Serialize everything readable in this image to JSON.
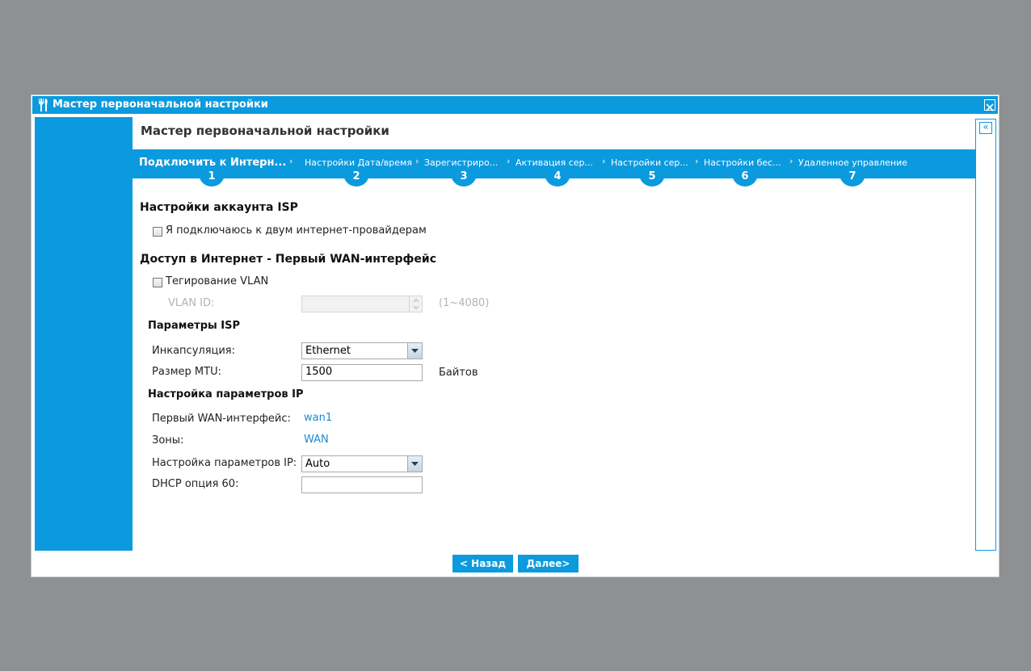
{
  "window": {
    "title": "Мастер первоначальной настройки",
    "title_icon": "tools-icon",
    "close_icon": "close-icon",
    "collapse_icon": "double-chevron-left-icon",
    "collapse_glyph": "«"
  },
  "wizard": {
    "title": "Мастер первоначальной настройки",
    "accent_color": "#0b9ade",
    "steps": [
      {
        "label": "Подключить к Интерн...",
        "number": "1",
        "active": true
      },
      {
        "label": "Настройки Дата/время",
        "number": "2"
      },
      {
        "label": "Зарегистриро...",
        "number": "3"
      },
      {
        "label": "Активация сер...",
        "number": "4"
      },
      {
        "label": "Настройки сер...",
        "number": "5"
      },
      {
        "label": "Настройки бес...",
        "number": "6"
      },
      {
        "label": "Удаленное управление",
        "number": "7"
      }
    ]
  },
  "isp_account": {
    "heading": "Настройки аккаунта ISP",
    "dual_isp_label": "Я подключаюсь к двум интернет-провайдерам",
    "dual_isp_checked": false
  },
  "internet_access": {
    "heading": "Доступ в Интернет - Первый WAN-интерфейс",
    "vlan_tagging_label": "Тегирование VLAN",
    "vlan_tagging_checked": false,
    "vlan_id_label": "VLAN ID:",
    "vlan_id_value": "",
    "vlan_id_range": "(1~4080)"
  },
  "isp_params": {
    "heading": "Параметры ISP",
    "encapsulation_label": "Инкапсуляция:",
    "encapsulation_value": "Ethernet",
    "mtu_label": "Размер MTU:",
    "mtu_value": "1500",
    "mtu_unit": "Байтов"
  },
  "ip_params": {
    "heading": "Настройка параметров IP",
    "wan_label": "Первый WAN-интерфейс:",
    "wan_value": "wan1",
    "zones_label": "Зоны:",
    "zones_value": "WAN",
    "ip_setting_label": "Настройка параметров IP:",
    "ip_setting_value": "Auto",
    "dhcp60_label": "DHCP опция 60:",
    "dhcp60_value": ""
  },
  "footer": {
    "back_label": "< Назад",
    "next_label": "Далее>"
  }
}
